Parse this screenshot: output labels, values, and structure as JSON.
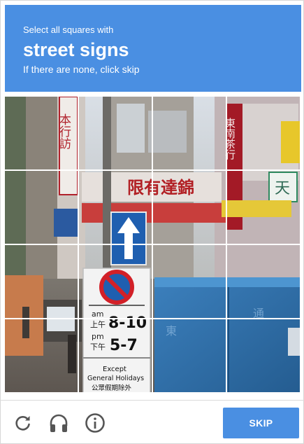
{
  "challenge": {
    "instruction": "Select all squares with",
    "target": "street signs",
    "hint": "If there are none, click skip"
  },
  "tiles": [
    {
      "row": 1,
      "col": 1
    },
    {
      "row": 1,
      "col": 2
    },
    {
      "row": 1,
      "col": 3
    },
    {
      "row": 1,
      "col": 4
    },
    {
      "row": 2,
      "col": 1
    },
    {
      "row": 2,
      "col": 2
    },
    {
      "row": 2,
      "col": 3
    },
    {
      "row": 2,
      "col": 4
    },
    {
      "row": 3,
      "col": 1
    },
    {
      "row": 3,
      "col": 2
    },
    {
      "row": 3,
      "col": 3
    },
    {
      "row": 3,
      "col": 4
    },
    {
      "row": 4,
      "col": 1
    },
    {
      "row": 4,
      "col": 2
    },
    {
      "row": 4,
      "col": 3
    },
    {
      "row": 4,
      "col": 4
    }
  ],
  "scene_text": {
    "sign_am": "am",
    "sign_am_cn": "上午",
    "sign_am_time": "8-10",
    "sign_pm": "pm",
    "sign_pm_cn": "下午",
    "sign_pm_time": "5-7",
    "sign_except_1": "Except",
    "sign_except_2": "General Holidays",
    "sign_except_cn": "公眾假期除外",
    "shop_sign_1": "限有達錦",
    "shop_sign_2": "天",
    "vertical_sign_1": "東南茶行",
    "vertical_sign_2": "本行訪"
  },
  "footer": {
    "reload_icon": "reload-icon",
    "audio_icon": "headphones-icon",
    "info_icon": "info-icon",
    "skip_label": "SKIP"
  },
  "colors": {
    "accent": "#4a8fe2",
    "truck_blue": "#2e6fa8",
    "sign_red": "#c2202a",
    "sign_blue": "#1f5fb0"
  }
}
